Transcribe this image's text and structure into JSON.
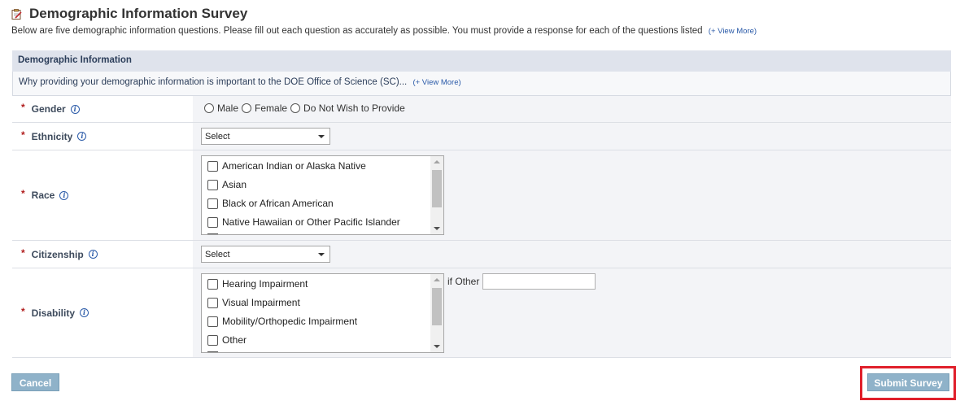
{
  "header": {
    "icon": "survey-clipboard-icon",
    "title": "Demographic Information Survey",
    "intro": "Below are five demographic information questions. Please fill out each question as accurately as possible. You must provide a response for each of the questions listed",
    "view_more": "(+ View More)"
  },
  "section": {
    "title": "Demographic Information",
    "subtitle": "Why providing your demographic information is important to the DOE Office of Science (SC)...",
    "view_more": "(+ View More)"
  },
  "fields": {
    "required_marker": "*",
    "info_glyph": "i",
    "gender": {
      "label": "Gender",
      "options": [
        "Male",
        "Female",
        "Do Not Wish to Provide"
      ]
    },
    "ethnicity": {
      "label": "Ethnicity",
      "selected": "Select"
    },
    "race": {
      "label": "Race",
      "options": [
        "American Indian or Alaska Native",
        "Asian",
        "Black or African American",
        "Native Hawaiian or Other Pacific Islander"
      ]
    },
    "citizenship": {
      "label": "Citizenship",
      "selected": "Select"
    },
    "disability": {
      "label": "Disability",
      "options": [
        "Hearing Impairment",
        "Visual Impairment",
        "Mobility/Orthopedic Impairment",
        "Other"
      ],
      "if_other_label": "if Other",
      "if_other_value": ""
    }
  },
  "actions": {
    "cancel": "Cancel",
    "submit": "Submit Survey"
  },
  "colors": {
    "required": "#b01c1c",
    "link": "#2a5aa8",
    "button": "#8fb2c9",
    "highlight": "#e0202b"
  }
}
